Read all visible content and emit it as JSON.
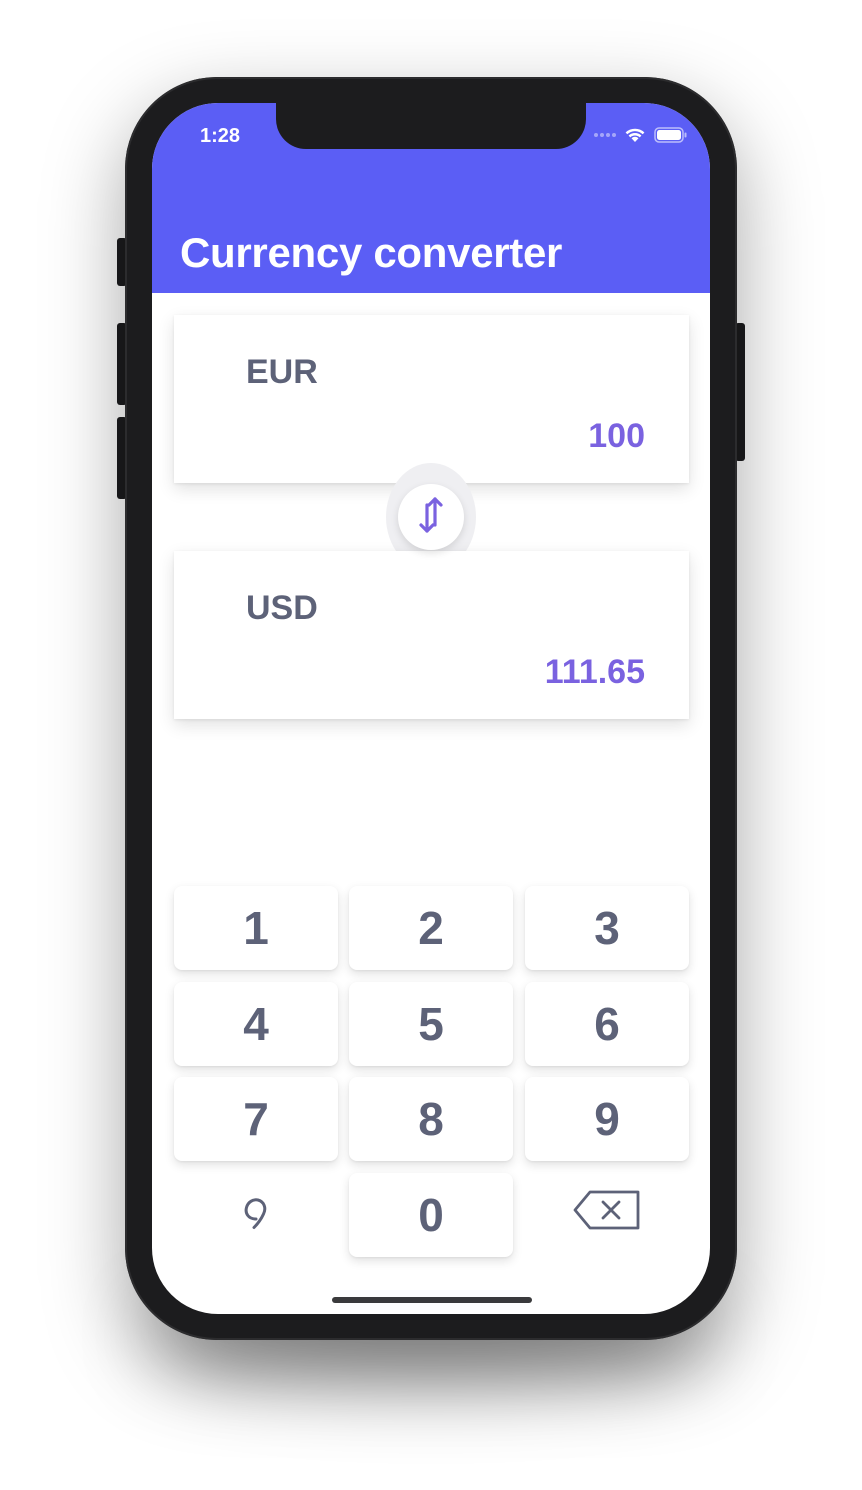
{
  "status_bar": {
    "time": "1:28",
    "icons": [
      "signal-icon",
      "wifi-icon",
      "battery-icon"
    ]
  },
  "header": {
    "title": "Currency converter",
    "background_color": "#5b5ef5"
  },
  "converter": {
    "from": {
      "currency": "EUR",
      "amount": "100"
    },
    "to": {
      "currency": "USD",
      "amount": "111.65"
    },
    "swap_icon": "swap-vertical-icon",
    "accent_color": "#7a62e0"
  },
  "keypad": {
    "keys": [
      "1",
      "2",
      "3",
      "4",
      "5",
      "6",
      "7",
      "8",
      "9",
      "0"
    ],
    "decimal_icon": "comma-icon",
    "backspace_icon": "backspace-icon"
  }
}
